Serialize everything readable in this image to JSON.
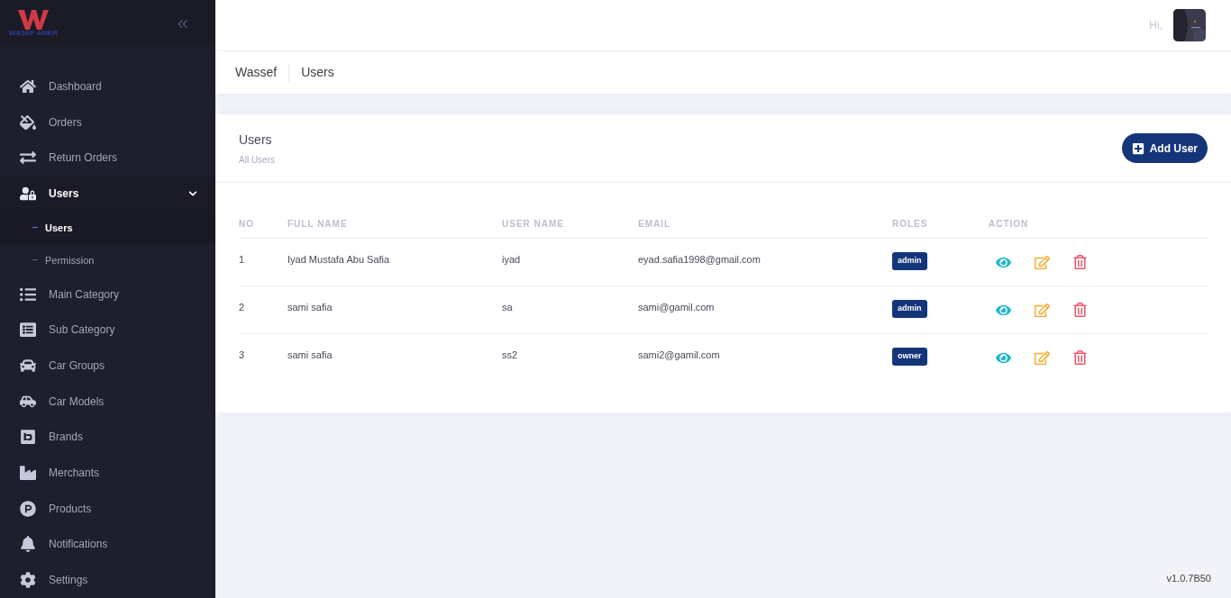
{
  "sidebar": {
    "logo_text": "WASEF AMER",
    "collapse_icon": "«",
    "items": [
      {
        "label": "Dashboard",
        "selected": false
      },
      {
        "label": "Orders",
        "selected": false
      },
      {
        "label": "Return Orders",
        "selected": false
      },
      {
        "label": "Users",
        "selected": true,
        "expanded": true,
        "children": [
          {
            "label": "Users",
            "selected": true
          },
          {
            "label": "Permission",
            "selected": false
          }
        ]
      },
      {
        "label": "Main Category",
        "selected": false
      },
      {
        "label": "Sub Category",
        "selected": false
      },
      {
        "label": "Car Groups",
        "selected": false
      },
      {
        "label": "Car Models",
        "selected": false
      },
      {
        "label": "Brands",
        "selected": false
      },
      {
        "label": "Merchants",
        "selected": false
      },
      {
        "label": "Products",
        "selected": false
      },
      {
        "label": "Notifications",
        "selected": false
      },
      {
        "label": "Settings",
        "selected": false
      }
    ]
  },
  "topbar": {
    "greeting": "Hi,"
  },
  "breadcrumb": [
    "Wassef",
    "Users"
  ],
  "card": {
    "title": "Users",
    "subtitle": "All Users",
    "add_button": "Add User",
    "table": {
      "columns": [
        "NO",
        "FULL NAME",
        "USER NAME",
        "EMAIL",
        "ROLES",
        "ACTION"
      ],
      "rows": [
        {
          "no": "1",
          "full_name": "Iyad Mustafa Abu Safia",
          "user_name": "iyad",
          "email": "eyad.safia1998@gmail.com",
          "role": "admin"
        },
        {
          "no": "2",
          "full_name": "sami safia",
          "user_name": "sa",
          "email": "sami@gamil.com",
          "role": "admin"
        },
        {
          "no": "3",
          "full_name": "sami safia",
          "user_name": "ss2",
          "email": "sami2@gamil.com",
          "role": "owner"
        }
      ]
    }
  },
  "version": "v1.0.7B50"
}
